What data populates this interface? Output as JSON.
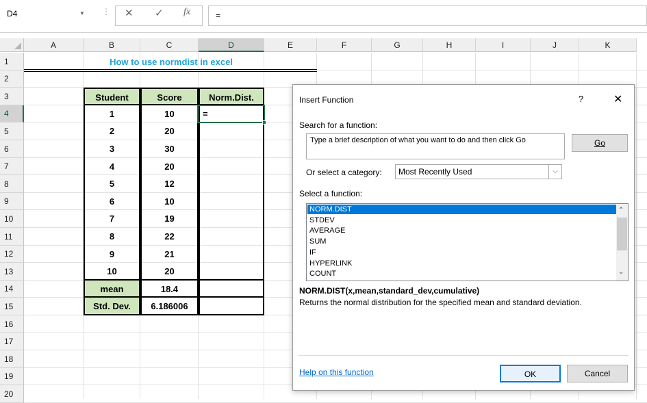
{
  "formula_bar": {
    "name_box": "D4",
    "cancel_icon": "✕",
    "enter_icon": "✓",
    "fx_icon": "fx",
    "formula": "="
  },
  "columns": [
    "A",
    "B",
    "C",
    "D",
    "E",
    "F",
    "G",
    "H",
    "I",
    "J",
    "K"
  ],
  "rows": [
    "1",
    "2",
    "3",
    "4",
    "5",
    "6",
    "7",
    "8",
    "9",
    "10",
    "11",
    "12",
    "13",
    "14",
    "15",
    "16",
    "17",
    "18",
    "19",
    "20"
  ],
  "sheet": {
    "title": "How to use normdist in excel",
    "headers": [
      "Student",
      "Score",
      "Norm.Dist."
    ],
    "students": [
      "1",
      "2",
      "3",
      "4",
      "5",
      "6",
      "7",
      "8",
      "9",
      "10"
    ],
    "scores": [
      "10",
      "20",
      "30",
      "20",
      "12",
      "10",
      "19",
      "22",
      "21",
      "20"
    ],
    "d4_value": "=",
    "mean_label": "mean",
    "mean_value": "18.4",
    "std_label": "Std. Dev.",
    "std_value": "6.186006"
  },
  "dialog": {
    "title": "Insert Function",
    "help_icon": "?",
    "close_icon": "✕",
    "search_label": "Search for a function:",
    "search_text": "Type a brief description of what you want to do and then click Go",
    "go_label": "Go",
    "category_label": "Or select a category:",
    "category_value": "Most Recently Used",
    "select_label": "Select a function:",
    "functions": [
      "NORM.DIST",
      "STDEV",
      "AVERAGE",
      "SUM",
      "IF",
      "HYPERLINK",
      "COUNT"
    ],
    "syntax": "NORM.DIST(x,mean,standard_dev,cumulative)",
    "description": "Returns the normal distribution for the specified mean and standard deviation.",
    "help_link": "Help on this function",
    "ok_label": "OK",
    "cancel_label": "Cancel"
  },
  "colors": {
    "accent": "#217346",
    "title": "#1fa1d8",
    "header_fill": "#cfe6bc",
    "selection": "#0078d7"
  }
}
